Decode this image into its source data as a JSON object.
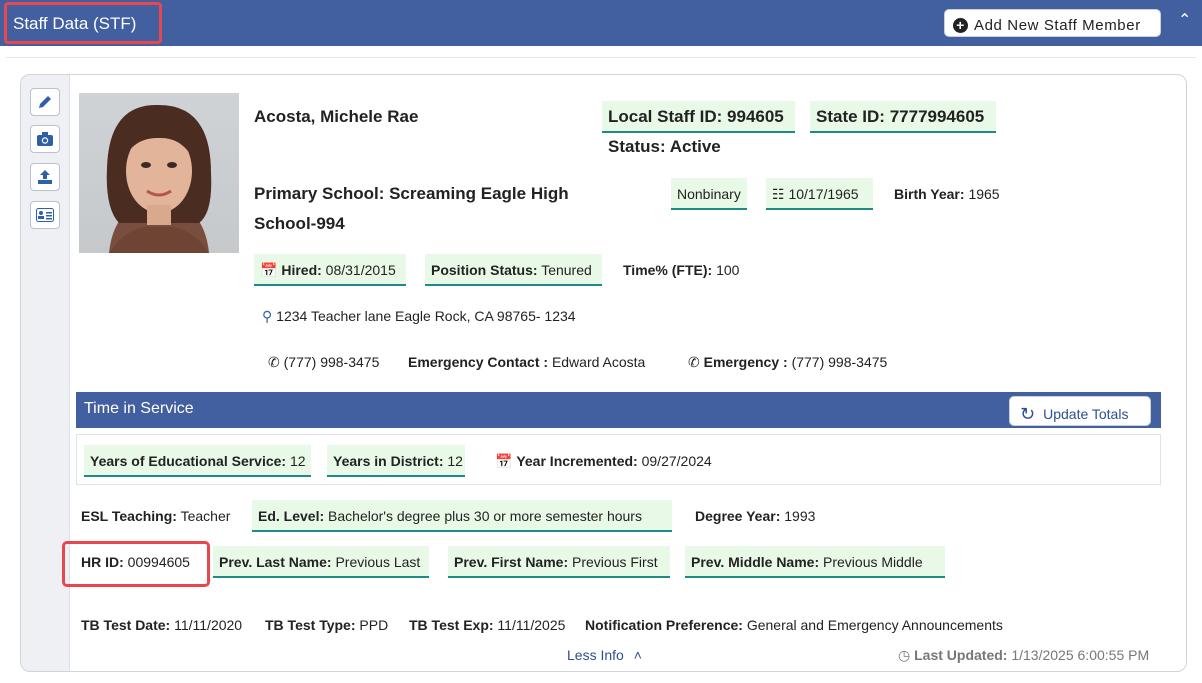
{
  "header": {
    "title": "Staff Data (STF)",
    "add_button_label": "Add New Staff Member"
  },
  "staff": {
    "name": "Acosta, Michele Rae",
    "local_id_label": "Local Staff ID:",
    "local_id": "994605",
    "state_id_label": "State ID:",
    "state_id": "7777994605",
    "status": "Status: Active",
    "primary_school_line1": "Primary School: Screaming Eagle High",
    "primary_school_line2": "School-994",
    "gender": "Nonbinary",
    "birth_date": "10/17/1965",
    "birth_year_label": "Birth Year:",
    "birth_year": "1965",
    "hired_label": "Hired:",
    "hired": "08/31/2015",
    "position_status_label": "Position Status:",
    "position_status": "Tenured",
    "fte_label": "Time% (FTE):",
    "fte": "100",
    "address": "1234 Teacher lane Eagle Rock, CA 98765- 1234",
    "phone": "(777) 998-3475",
    "emergency_contact_label": "Emergency Contact :",
    "emergency_contact": "Edward Acosta",
    "emergency_phone_label": "Emergency :",
    "emergency_phone": "(777) 998-3475"
  },
  "time_in_service": {
    "title": "Time in Service",
    "update_button": "Update Totals",
    "years_edu_label": "Years of Educational Service:",
    "years_edu": "12",
    "years_district_label": "Years in District:",
    "years_district": "12",
    "year_incremented_label": "Year Incremented:",
    "year_incremented": "09/27/2024"
  },
  "details": {
    "esl_label": "ESL Teaching:",
    "esl": "Teacher",
    "ed_level_label": "Ed. Level:",
    "ed_level": "Bachelor's degree plus 30 or more semester hours",
    "degree_year_label": "Degree Year:",
    "degree_year": "1993",
    "hr_id_label": "HR ID:",
    "hr_id": "00994605",
    "prev_last_label": "Prev. Last Name:",
    "prev_last": "Previous Last",
    "prev_first_label": "Prev. First Name:",
    "prev_first": "Previous First",
    "prev_middle_label": "Prev. Middle Name:",
    "prev_middle": "Previous Middle",
    "tb_date_label": "TB Test Date:",
    "tb_date": "11/11/2020",
    "tb_type_label": "TB Test Type:",
    "tb_type": "PPD",
    "tb_exp_label": "TB Test Exp:",
    "tb_exp": "11/11/2025",
    "notif_label": "Notification Preference:",
    "notif": "General and Emergency Announcements"
  },
  "footer": {
    "less_info": "Less Info",
    "last_updated_label": "Last Updated:",
    "last_updated": "1/13/2025 6:00:55 PM"
  },
  "icons": [
    "plus-circle-icon",
    "chevron-up-icon",
    "pencil-icon",
    "camera-icon",
    "upload-icon",
    "id-card-icon",
    "calendar-icon",
    "birthday-cake-icon",
    "map-pin-icon",
    "phone-icon",
    "refresh-icon",
    "clock-icon"
  ],
  "colors": {
    "header_blue": "#42609f",
    "highlight_red": "#e8474e",
    "pill_green": "#e9f9e7",
    "pill_underline": "#1f8a8a"
  }
}
